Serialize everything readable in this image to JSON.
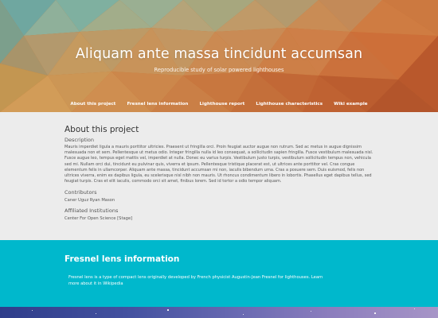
{
  "hero": {
    "title": "Aliquam ante massa tincidunt accumsan",
    "subtitle": "Reproducible study of solar powered lighthouses",
    "nav": [
      {
        "label": "About this project"
      },
      {
        "label": "Fresnel lens information"
      },
      {
        "label": "Lighthouse report"
      },
      {
        "label": "Lighthouse characteristics"
      },
      {
        "label": "Wiki example"
      }
    ]
  },
  "about": {
    "heading": "About this project",
    "description_label": "Description",
    "description": "Mauris imperdiet ligula a mauris porttitor ultricies. Praesent ut fringilla orci. Proin feugiat auctor augue non rutrum. Sed ac metus in augue dignissim malesuada non et sem. Pellentesque ut metus odio. Integer fringilla nulla id leo consequat, a sollicitudin sapien fringilla. Fusce vestibulum malesuada nisl. Fusce augue leo, tempus eget mattis vel, imperdiet at nulla. Donec eu varius turpis. Vestibulum justo turpis, vestibulum sollicitudin tempus non, vehicula sed mi. Nullam orci dui, tincidunt eu pulvinar quis, viverra et ipsum. Pellentesque tristique placerat est, ut ultrices ante porttitor vel. Cras congue elementum felis in ullamcorper. Aliquam ante massa, tincidunt accumsan mi non, iaculis bibendum urna. Cras a posuere sem. Duis euismod, felis non ultrices viverra, enim ex dapibus ligula, eu scelerisque nisl nibh non mauris. Ut rhoncus condimentum libero in lobortis. Phasellus eget dapibus tellus, sed feugiat turpis. Cras et elit iaculis, commodo orci sit amet, finibus lorem. Sed id tortor a odio tempor aliquam.",
    "contributors_label": "Contributors",
    "contributors": "Caner Uguz Ryan Mason",
    "institutions_label": "Affiliated Institutions",
    "institutions": "Center For Open Science [Stage]"
  },
  "fresnel": {
    "heading": "Fresnel lens information",
    "text": "Fresnel lens is a type of compact lens originally developed by French physicist Augustin-Jean Fresnel for lighthouses. Learn more about it in Wikipedia"
  },
  "colors": {
    "hero_orange": "#c9722f",
    "fresnel_cyan": "#00b8cc",
    "page_bg": "#ececec"
  }
}
